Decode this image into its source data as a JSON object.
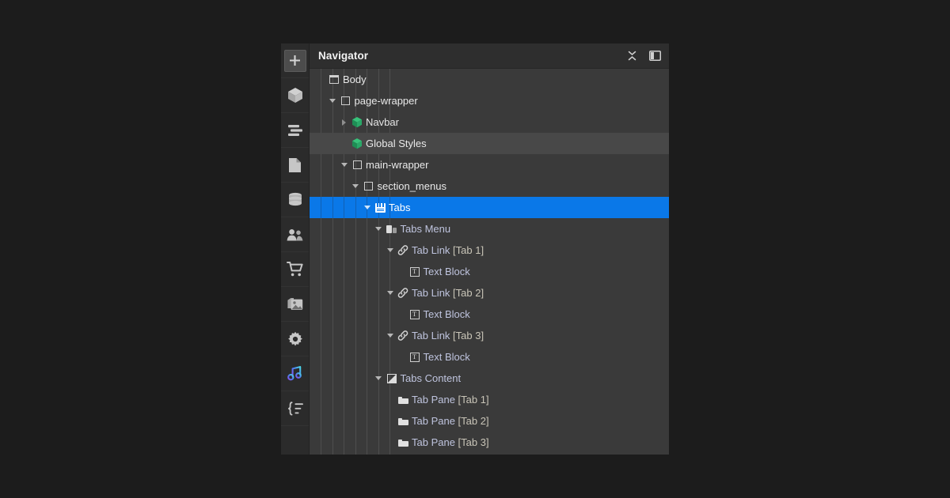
{
  "panel": {
    "title": "Navigator",
    "header_actions": [
      {
        "name": "collapse-all-icon",
        "label": "Collapse all"
      },
      {
        "name": "panel-toggle-icon",
        "label": "Toggle panel"
      }
    ]
  },
  "rail": {
    "items": [
      {
        "name": "add-elements-button",
        "icon": "plus-icon",
        "label": "Add Elements",
        "active": true
      },
      {
        "name": "components-button",
        "icon": "cube-icon",
        "label": "Components",
        "active": false
      },
      {
        "name": "navigator-button",
        "icon": "navigator-icon",
        "label": "Navigator",
        "active": false
      },
      {
        "name": "pages-button",
        "icon": "page-icon",
        "label": "Pages",
        "active": false
      },
      {
        "name": "cms-button",
        "icon": "database-icon",
        "label": "CMS",
        "active": false
      },
      {
        "name": "users-button",
        "icon": "users-icon",
        "label": "Users",
        "active": false
      },
      {
        "name": "ecommerce-button",
        "icon": "cart-icon",
        "label": "Ecommerce",
        "active": false
      },
      {
        "name": "assets-button",
        "icon": "image-stack-icon",
        "label": "Assets",
        "active": false
      },
      {
        "name": "settings-button",
        "icon": "gear-icon",
        "label": "Settings",
        "active": false
      },
      {
        "name": "interactions-button",
        "icon": "interactions-icon",
        "label": "Interactions",
        "active": false
      },
      {
        "name": "custom-code-button",
        "icon": "variables-icon",
        "label": "Variables",
        "active": false
      }
    ]
  },
  "colors": {
    "selection_blue": "#0a78e8",
    "panel_bg": "#3a3a3a",
    "header_bg": "#2e2e2e",
    "rail_bg": "#2b2b2b",
    "hover_bg": "#484848",
    "page_bg": "#1c1c1c",
    "symbol_green": "#2fbf71"
  },
  "tree": {
    "nodes": [
      {
        "label": "Body",
        "suffix": "",
        "depth": 0,
        "icon": "browser-window-icon",
        "arrow": "none",
        "state": "normal",
        "color": "white"
      },
      {
        "label": "page-wrapper",
        "suffix": "",
        "depth": 1,
        "icon": "div-block-icon",
        "arrow": "down",
        "state": "normal",
        "color": "white"
      },
      {
        "label": "Navbar",
        "suffix": "",
        "depth": 2,
        "icon": "symbol-icon",
        "arrow": "right",
        "state": "normal",
        "color": "green"
      },
      {
        "label": "Global Styles",
        "suffix": "",
        "depth": 2,
        "icon": "symbol-icon",
        "arrow": "none",
        "state": "hover",
        "color": "white"
      },
      {
        "label": "main-wrapper",
        "suffix": "",
        "depth": 2,
        "icon": "div-block-icon",
        "arrow": "down",
        "state": "normal",
        "color": "white"
      },
      {
        "label": "section_menus",
        "suffix": "",
        "depth": 3,
        "icon": "div-block-icon",
        "arrow": "down",
        "state": "normal",
        "color": "white"
      },
      {
        "label": "Tabs",
        "suffix": "",
        "depth": 4,
        "icon": "tabs-icon",
        "arrow": "down",
        "state": "selected",
        "color": "white"
      },
      {
        "label": "Tabs Menu",
        "suffix": "",
        "depth": 5,
        "icon": "tabs-menu-icon",
        "arrow": "down",
        "state": "normal",
        "color": "lavender"
      },
      {
        "label": "Tab Link ",
        "suffix": "[Tab 1]",
        "depth": 6,
        "icon": "link-icon",
        "arrow": "down",
        "state": "normal",
        "color": "lavender"
      },
      {
        "label": "Text Block",
        "suffix": "",
        "depth": 7,
        "icon": "text-block-icon",
        "arrow": "none",
        "state": "normal",
        "color": "lavender"
      },
      {
        "label": "Tab Link ",
        "suffix": "[Tab 2]",
        "depth": 6,
        "icon": "link-icon",
        "arrow": "down",
        "state": "normal",
        "color": "lavender"
      },
      {
        "label": "Text Block",
        "suffix": "",
        "depth": 7,
        "icon": "text-block-icon",
        "arrow": "none",
        "state": "normal",
        "color": "lavender"
      },
      {
        "label": "Tab Link ",
        "suffix": "[Tab 3]",
        "depth": 6,
        "icon": "link-icon",
        "arrow": "down",
        "state": "normal",
        "color": "lavender"
      },
      {
        "label": "Text Block",
        "suffix": "",
        "depth": 7,
        "icon": "text-block-icon",
        "arrow": "none",
        "state": "normal",
        "color": "lavender"
      },
      {
        "label": "Tabs Content",
        "suffix": "",
        "depth": 5,
        "icon": "tabs-content-icon",
        "arrow": "down",
        "state": "normal",
        "color": "lavender"
      },
      {
        "label": "Tab Pane ",
        "suffix": "[Tab 1]",
        "depth": 6,
        "icon": "tab-pane-icon",
        "arrow": "none",
        "state": "normal",
        "color": "lavender"
      },
      {
        "label": "Tab Pane ",
        "suffix": "[Tab 2]",
        "depth": 6,
        "icon": "tab-pane-icon",
        "arrow": "none",
        "state": "normal",
        "color": "lavender"
      },
      {
        "label": "Tab Pane ",
        "suffix": "[Tab 3]",
        "depth": 6,
        "icon": "tab-pane-icon",
        "arrow": "none",
        "state": "normal",
        "color": "lavender"
      }
    ]
  }
}
